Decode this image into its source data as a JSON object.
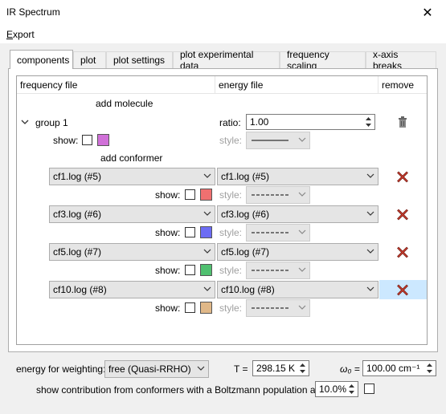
{
  "window": {
    "title": "IR Spectrum",
    "close_glyph": "✕"
  },
  "menu": {
    "items": [
      "Export"
    ]
  },
  "tabs": [
    {
      "label": "components",
      "active": true
    },
    {
      "label": "plot"
    },
    {
      "label": "plot settings"
    },
    {
      "label": "plot experimental data"
    },
    {
      "label": "frequency scaling"
    },
    {
      "label": "x-axis breaks"
    }
  ],
  "table": {
    "headers": {
      "frequency": "frequency file",
      "energy": "energy file",
      "remove": "remove"
    },
    "add_molecule": "add molecule",
    "group": {
      "label": "group 1",
      "ratio_label": "ratio:",
      "ratio_value": "1.00",
      "show_label": "show:",
      "style_label": "style:",
      "color": "#d070d8",
      "add_conformer": "add conformer"
    },
    "conformers": [
      {
        "frequency": "cf1.log (#5)",
        "energy": "cf1.log (#5)",
        "show_label": "show:",
        "style_label": "style:",
        "color": "#f07070"
      },
      {
        "frequency": "cf3.log (#6)",
        "energy": "cf3.log (#6)",
        "show_label": "show:",
        "style_label": "style:",
        "color": "#6c6cf4"
      },
      {
        "frequency": "cf5.log (#7)",
        "energy": "cf5.log (#7)",
        "show_label": "show:",
        "style_label": "style:",
        "color": "#50c070"
      },
      {
        "frequency": "cf10.log (#8)",
        "energy": "cf10.log (#8)",
        "show_label": "show:",
        "style_label": "style:",
        "color": "#e0b888"
      }
    ]
  },
  "bottom": {
    "weighting_label": "energy for weighting:",
    "weighting_value": "free (Quasi-RRHO)",
    "T_label": "T =",
    "T_value": "298.15 K",
    "omega_label": "ω₀ =",
    "omega_value": "100.00 cm⁻¹",
    "boltzmann_label": "show contribution from conformers with a Boltzmann population above:",
    "boltzmann_value": "10.0%"
  }
}
